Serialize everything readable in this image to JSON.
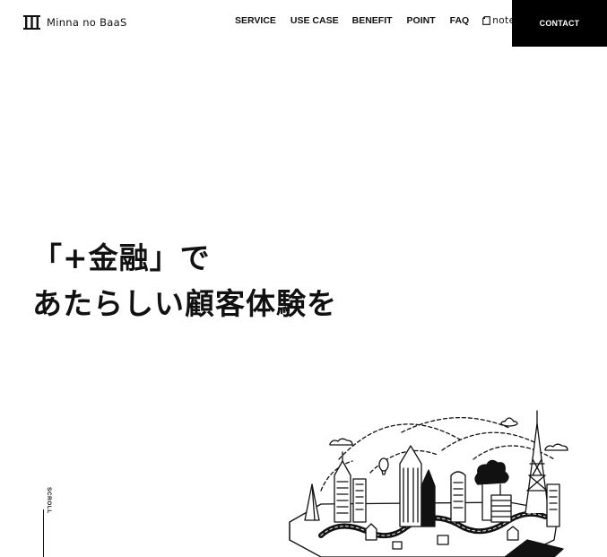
{
  "header": {
    "logo_text": "Minna no BaaS",
    "nav": [
      {
        "label": "SERVICE"
      },
      {
        "label": "USE CASE"
      },
      {
        "label": "BENEFIT"
      },
      {
        "label": "POINT"
      },
      {
        "label": "FAQ"
      }
    ],
    "note_label": "note",
    "contact_label": "CONTACT"
  },
  "hero": {
    "line1": "「+金融」で",
    "line2": "あたらしい顧客体験を"
  },
  "scroll": {
    "label": "SCROLL"
  },
  "colors": {
    "background": "#ffffff",
    "text": "#111111",
    "contact_bg": "#000000",
    "contact_text": "#ffffff"
  },
  "icons": {
    "logo": "triple-bar-logo-icon",
    "note": "note-document-icon",
    "illustration": "city-illustration"
  }
}
